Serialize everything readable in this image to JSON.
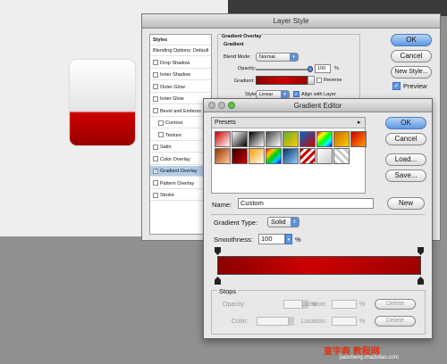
{
  "layer_style": {
    "title": "Layer Style",
    "styles_header": "Styles",
    "items": [
      {
        "label": "Blending Options: Default",
        "checkbox": false,
        "checked": false,
        "selected": false
      },
      {
        "label": "Drop Shadow",
        "checkbox": true,
        "checked": false,
        "selected": false
      },
      {
        "label": "Inner Shadow",
        "checkbox": true,
        "checked": false,
        "selected": false
      },
      {
        "label": "Outer Glow",
        "checkbox": true,
        "checked": false,
        "selected": false
      },
      {
        "label": "Inner Glow",
        "checkbox": true,
        "checked": false,
        "selected": false
      },
      {
        "label": "Bevel and Emboss",
        "checkbox": true,
        "checked": false,
        "selected": false
      },
      {
        "label": "Contour",
        "checkbox": true,
        "checked": false,
        "selected": false
      },
      {
        "label": "Texture",
        "checkbox": true,
        "checked": false,
        "selected": false
      },
      {
        "label": "Satin",
        "checkbox": true,
        "checked": false,
        "selected": false
      },
      {
        "label": "Color Overlay",
        "checkbox": true,
        "checked": false,
        "selected": false
      },
      {
        "label": "Gradient Overlay",
        "checkbox": true,
        "checked": true,
        "selected": true
      },
      {
        "label": "Pattern Overlay",
        "checkbox": true,
        "checked": false,
        "selected": false
      },
      {
        "label": "Stroke",
        "checkbox": true,
        "checked": false,
        "selected": false
      }
    ],
    "group_title": "Gradient Overlay",
    "subgroup_title": "Gradient",
    "blend_mode_label": "Blend Mode:",
    "blend_mode_value": "Normal",
    "opacity_label": "Opacity:",
    "opacity_value": "100",
    "opacity_unit": "%",
    "gradient_label": "Gradient:",
    "reverse_label": "Reverse",
    "style_label": "Style:",
    "style_value": "Linear",
    "align_label": "Align with Layer",
    "buttons": {
      "ok": "OK",
      "cancel": "Cancel",
      "new_style": "New Style...",
      "preview": "Preview"
    }
  },
  "gradient_editor": {
    "title": "Gradient Editor",
    "presets_label": "Presets",
    "buttons": {
      "ok": "OK",
      "cancel": "Cancel",
      "load": "Load...",
      "save": "Save...",
      "new": "New"
    },
    "name_label": "Name:",
    "name_value": "Custom",
    "type_label": "Gradient Type:",
    "type_value": "Solid",
    "smoothness_label": "Smoothness:",
    "smoothness_value": "100",
    "smoothness_unit": "%",
    "stops_title": "Stops",
    "opacity_label": "Opacity:",
    "opacity_unit": "%",
    "location_label": "Location:",
    "location_unit": "%",
    "delete_label": "Delete",
    "color_label": "Color:"
  },
  "watermark": {
    "text": "查字典 教程网",
    "url": "jiaocheng.chazidian.com"
  },
  "colors": {
    "accent": "#5d97e3",
    "gradient_dark": "#8a0000",
    "gradient_mid": "#cc0000"
  }
}
